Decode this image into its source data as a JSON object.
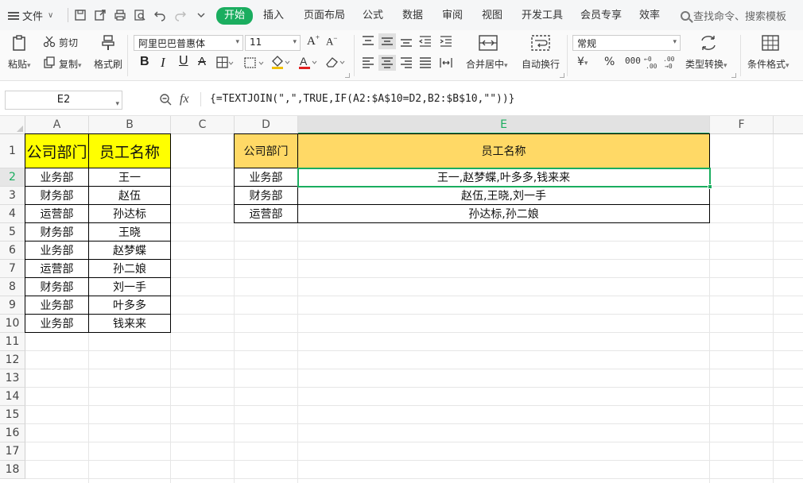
{
  "menubar": {
    "file_label": "文件",
    "tabs": [
      {
        "label": "开始",
        "active": true
      },
      {
        "label": "插入"
      },
      {
        "label": "页面布局"
      },
      {
        "label": "公式"
      },
      {
        "label": "数据"
      },
      {
        "label": "审阅"
      },
      {
        "label": "视图"
      },
      {
        "label": "开发工具"
      },
      {
        "label": "会员专享"
      },
      {
        "label": "效率"
      }
    ],
    "search_placeholder": "查找命令、搜索模板"
  },
  "ribbon": {
    "paste": "粘贴",
    "cut": "剪切",
    "copy": "复制",
    "format_painter": "格式刷",
    "font_name": "阿里巴巴普惠体",
    "font_size": "11",
    "bold": "B",
    "italic": "I",
    "underline": "U",
    "merge_center": "合并居中",
    "wrap_text": "自动换行",
    "number_format": "常规",
    "currency": "¥",
    "percent": "%",
    "thousands": "000",
    "type_convert": "类型转换",
    "conditional_format": "条件格式"
  },
  "formula_bar": {
    "name_box": "E2",
    "fx": "fx",
    "formula": "{=TEXTJOIN(\",\",TRUE,IF(A2:$A$10=D2,B2:$B$10,\"\"))}"
  },
  "grid": {
    "columns": [
      "A",
      "B",
      "C",
      "D",
      "E",
      "F"
    ],
    "rows": [
      "1",
      "2",
      "3",
      "4",
      "5",
      "6",
      "7",
      "8",
      "9",
      "10",
      "11",
      "12",
      "13",
      "14",
      "15",
      "16",
      "17",
      "18"
    ],
    "table1": {
      "header": [
        "公司部门",
        "员工名称"
      ],
      "rows": [
        [
          "业务部",
          "王一"
        ],
        [
          "财务部",
          "赵伍"
        ],
        [
          "运营部",
          "孙达标"
        ],
        [
          "财务部",
          "王晓"
        ],
        [
          "业务部",
          "赵梦蝶"
        ],
        [
          "运营部",
          "孙二娘"
        ],
        [
          "财务部",
          "刘一手"
        ],
        [
          "业务部",
          "叶多多"
        ],
        [
          "业务部",
          "钱来来"
        ]
      ]
    },
    "table2": {
      "header": [
        "公司部门",
        "员工名称"
      ],
      "rows": [
        [
          "业务部",
          "王一,赵梦蝶,叶多多,钱来来"
        ],
        [
          "财务部",
          "赵伍,王晓,刘一手"
        ],
        [
          "运营部",
          "孙达标,孙二娘"
        ]
      ]
    }
  },
  "colors": {
    "accent": "#1aad5f",
    "header_yellow": "#ffff00",
    "header_gold": "#ffd966"
  }
}
